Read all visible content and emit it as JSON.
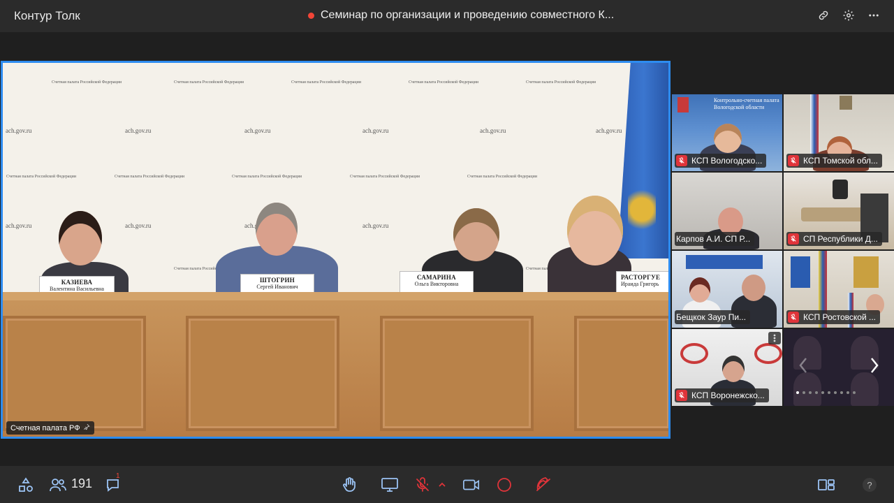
{
  "app": {
    "title": "Контур Толк"
  },
  "meeting": {
    "title": "Семинар по организации и проведению совместного К..."
  },
  "stage": {
    "label": "Счетная палата РФ",
    "backdrop_org": "Счетная палата Российской Федерации",
    "backdrop_url": "ach.gov.ru",
    "nameplates": [
      {
        "surname": "КАЗИЕВА",
        "given": "Валентина Васильевна"
      },
      {
        "surname": "ШТОГРИН",
        "given": "Сергей Иванович"
      },
      {
        "surname": "САМАРИНА",
        "given": "Ольга Викторовна"
      },
      {
        "surname": "РАСТОРГУЕ",
        "given": "Ираида Григорь"
      }
    ]
  },
  "tiles": [
    {
      "label": "КСП Вологодско...",
      "banner": "Контрольно-счетная палата Вологодской области"
    },
    {
      "label": "КСП Томской обл..."
    },
    {
      "label": "Карпов А.И. СП Р..."
    },
    {
      "label": "СП Республики Д..."
    },
    {
      "label": "Бещкок Заур Пи..."
    },
    {
      "label": "КСП Ростовской ..."
    },
    {
      "label": "КСП Воронежско..."
    }
  ],
  "pager": {
    "pages": 10,
    "current": 1
  },
  "toolbar": {
    "participants_count": "191",
    "chat_badge": "1"
  },
  "colors": {
    "accent": "#2d8cf0",
    "record": "#f24537",
    "mute": "#e0343a",
    "end_call": "#e0343a"
  }
}
